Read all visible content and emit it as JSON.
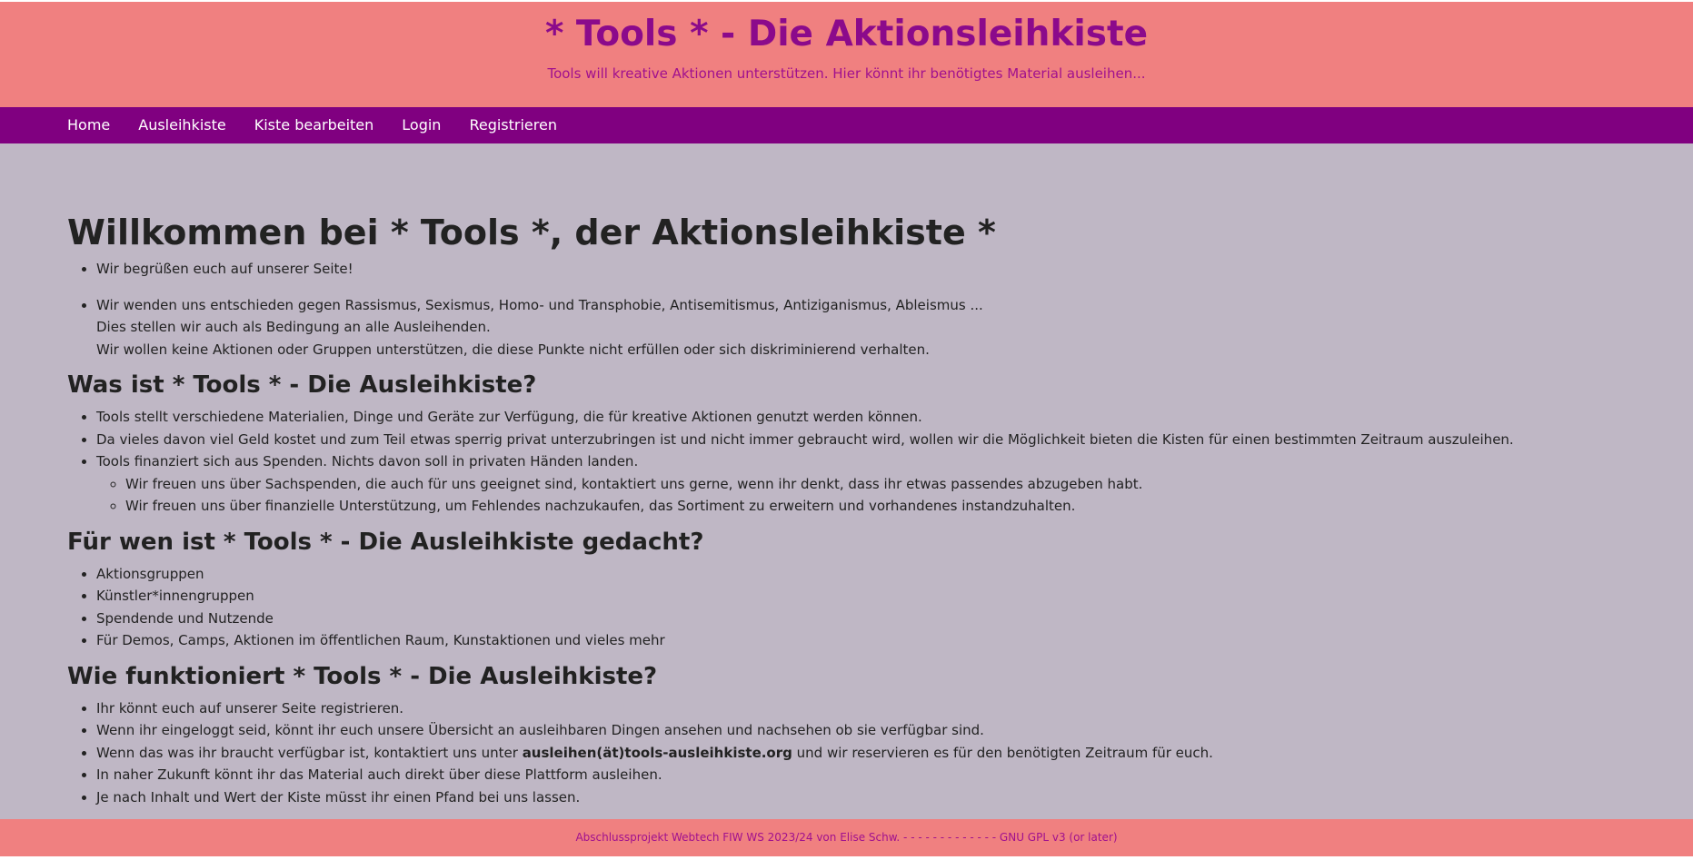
{
  "header": {
    "title": "* Tools * - Die Aktionsleihkiste",
    "tagline": "Tools will kreative Aktionen unterstützen. Hier könnt ihr benötigtes Material ausleihen..."
  },
  "nav": {
    "items": [
      "Home",
      "Ausleihkiste",
      "Kiste bearbeiten",
      "Login",
      "Registrieren"
    ]
  },
  "main": {
    "heading": "Willkommen bei * Tools *, der Aktionsleihkiste *",
    "intro": {
      "item1": "Wir begrüßen euch auf unserer Seite!",
      "item2_line1": "Wir wenden uns entschieden gegen Rassismus, Sexismus, Homo- und Transphobie, Antisemitismus, Antiziganismus, Ableismus ...",
      "item2_line2": "Dies stellen wir auch als Bedingung an alle Ausleihenden.",
      "item2_line3": "Wir wollen keine Aktionen oder Gruppen unterstützen, die diese Punkte nicht erfüllen oder sich diskriminierend verhalten."
    },
    "section_what": {
      "heading": "Was ist * Tools * - Die Ausleihkiste?",
      "item1": "Tools stellt verschiedene Materialien, Dinge und Geräte zur Verfügung, die für kreative Aktionen genutzt werden können.",
      "item2": "Da vieles davon viel Geld kostet und zum Teil etwas sperrig privat unterzubringen ist und nicht immer gebraucht wird, wollen wir die Möglichkeit bieten die Kisten für einen bestimmten Zeitraum auszuleihen.",
      "item3": "Tools finanziert sich aus Spenden. Nichts davon soll in privaten Händen landen.",
      "sub1": "Wir freuen uns über Sachspenden, die auch für uns geeignet sind, kontaktiert uns gerne, wenn ihr denkt, dass ihr etwas passendes abzugeben habt.",
      "sub2": "Wir freuen uns über finanzielle Unterstützung, um Fehlendes nachzukaufen, das Sortiment zu erweitern und vorhandenes instandzuhalten."
    },
    "section_who": {
      "heading": "Für wen ist * Tools * - Die Ausleihkiste gedacht?",
      "item1": "Aktionsgruppen",
      "item2": "Künstler*innengruppen",
      "item3": "Spendende und Nutzende",
      "item4": "Für Demos, Camps, Aktionen im öffentlichen Raum, Kunstaktionen und vieles mehr"
    },
    "section_how": {
      "heading": "Wie funktioniert * Tools * - Die Ausleihkiste?",
      "item1": "Ihr könnt euch auf unserer Seite registrieren.",
      "item2": "Wenn ihr eingeloggt seid, könnt ihr euch unsere Übersicht an ausleihbaren Dingen ansehen und nachsehen ob sie verfügbar sind.",
      "item3_before": "Wenn das was ihr braucht verfügbar ist, kontaktiert uns unter ",
      "item3_email": "ausleihen(ät)tools-ausleihkiste.org",
      "item3_after": " und wir reservieren es für den benötigten Zeitraum für euch.",
      "item4": "In naher Zukunft könnt ihr das Material auch direkt über diese Plattform ausleihen.",
      "item5": "Je nach Inhalt und Wert der Kiste müsst ihr einen Pfand bei uns lassen."
    }
  },
  "footer": {
    "text": "Abschlussprojekt Webtech FIW WS 2023/24 von Elise Schw. - - - - - - - - - - - - - GNU GPL v3 (or later)"
  },
  "colors": {
    "header_bg": "#f08080",
    "nav_bg": "#800080",
    "title": "#8b0a8b",
    "page_bg": "#bfb7c5"
  }
}
